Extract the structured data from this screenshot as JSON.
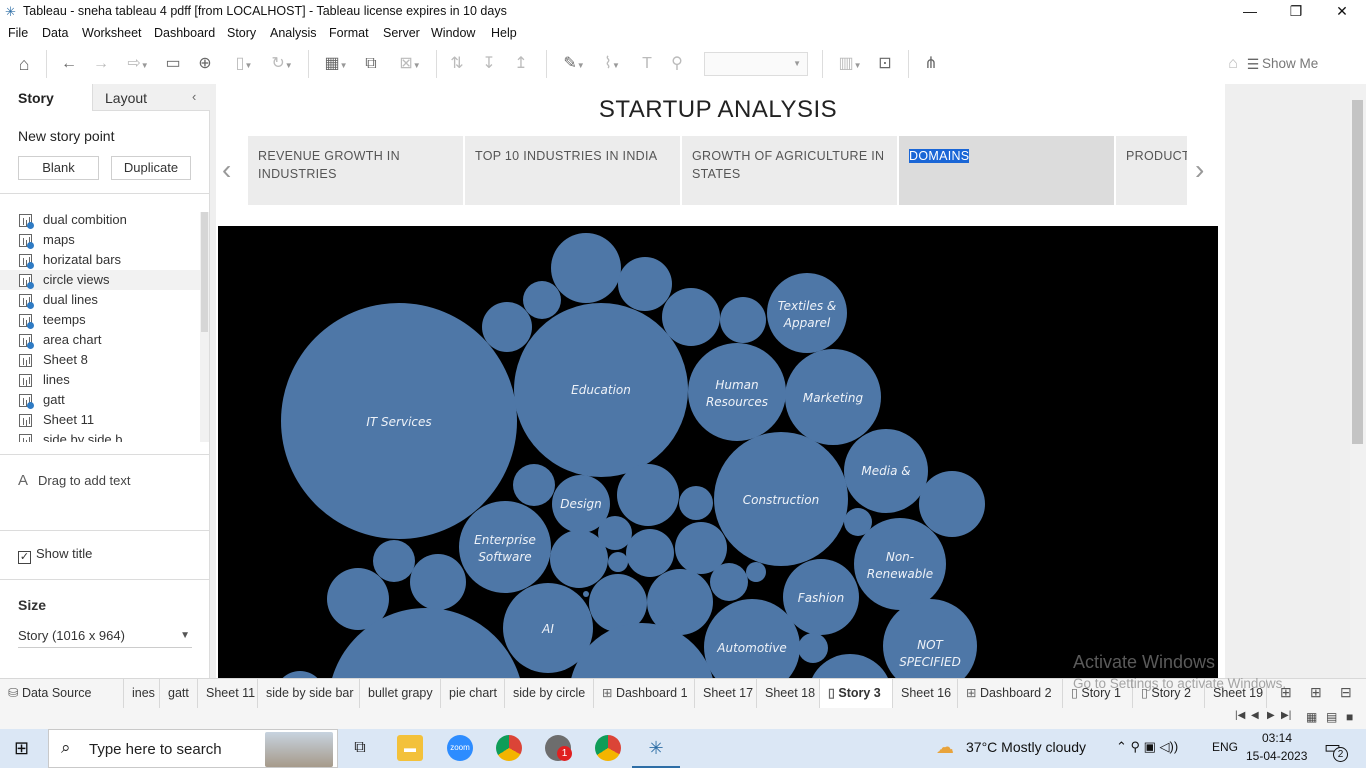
{
  "window": {
    "title": "Tableau - sneha tableau 4 pdff [from LOCALHOST] - Tableau license expires in 10 days",
    "minimize": "—",
    "restore": "❐",
    "close": "✕"
  },
  "menu": [
    "File",
    "Data",
    "Worksheet",
    "Dashboard",
    "Story",
    "Analysis",
    "Format",
    "Server",
    "Window",
    "Help"
  ],
  "toolbar": {
    "show_me": "Show Me"
  },
  "left_pane": {
    "tab_story": "Story",
    "tab_layout": "Layout",
    "new_story_point": "New story point",
    "blank_button": "Blank",
    "duplicate_button": "Duplicate",
    "sheets": [
      {
        "label": "dual combition",
        "used": true
      },
      {
        "label": "maps",
        "used": true
      },
      {
        "label": "horizatal bars",
        "used": true
      },
      {
        "label": "circle views",
        "used": true
      },
      {
        "label": "dual lines",
        "used": true
      },
      {
        "label": "teemps",
        "used": true
      },
      {
        "label": "area chart",
        "used": true
      },
      {
        "label": "Sheet 8",
        "used": false
      },
      {
        "label": "lines",
        "used": false
      },
      {
        "label": " gatt",
        "used": true
      },
      {
        "label": "Sheet 11",
        "used": false
      },
      {
        "label": "side by side b",
        "used": true
      }
    ],
    "drag_text": "Drag to add text",
    "show_title": "Show title",
    "show_title_checked": "✓",
    "size_label": "Size",
    "size_value": "Story (1016 x 964)"
  },
  "story": {
    "title": "STARTUP ANALYSIS",
    "points": [
      {
        "label": "REVENUE GROWTH IN INDUSTRIES"
      },
      {
        "label": "TOP 10 INDUSTRIES IN INDIA"
      },
      {
        "label": "GROWTH OF AGRICULTURE IN STATES"
      },
      {
        "label": "DOMAINS",
        "active": true
      },
      {
        "label": "PRODUCTI"
      }
    ]
  },
  "bubble_labels": {
    "it_services": "IT Services",
    "education": "Education",
    "textiles_1": "Textiles &",
    "textiles_2": "Apparel",
    "human_1": "Human",
    "human_2": "Resources",
    "marketing": "Marketing",
    "media": "Media &",
    "construction": "Construction",
    "design": "Design",
    "enterprise_1": "Enterprise",
    "enterprise_2": "Software",
    "nonrenew_1": "Non-",
    "nonrenew_2": "Renewable",
    "fashion": "Fashion",
    "ai": "AI",
    "automotive": "Automotive",
    "notspec_1": "NOT",
    "notspec_2": "SPECIFIED"
  },
  "bubble_color": "#4e77a7",
  "sheet_tabs": [
    {
      "label": "Data Source",
      "icon": "db"
    },
    {
      "label": "ines"
    },
    {
      "label": "gatt"
    },
    {
      "label": "Sheet 11"
    },
    {
      "label": "side by side bar"
    },
    {
      "label": "bullet grapy"
    },
    {
      "label": "pie chart"
    },
    {
      "label": "side by circle"
    },
    {
      "label": "Dashboard 1",
      "icon": "dash"
    },
    {
      "label": "Sheet 17"
    },
    {
      "label": "Sheet 18"
    },
    {
      "label": "Story 3",
      "icon": "story",
      "active": true
    },
    {
      "label": "Sheet 16"
    },
    {
      "label": "Dashboard 2",
      "icon": "dash"
    },
    {
      "label": "Story 1",
      "icon": "story"
    },
    {
      "label": "Story 2",
      "icon": "story"
    },
    {
      "label": "Sheet 19"
    }
  ],
  "watermark": {
    "line1": "Activate Windows",
    "line2": "Go to Settings to activate Windows."
  },
  "taskbar": {
    "search_placeholder": "Type here to search",
    "weather": "37°C  Mostly cloudy",
    "lang": "ENG",
    "time": "03:14",
    "date": "15-04-2023",
    "notifications": "2",
    "badge": "1"
  }
}
